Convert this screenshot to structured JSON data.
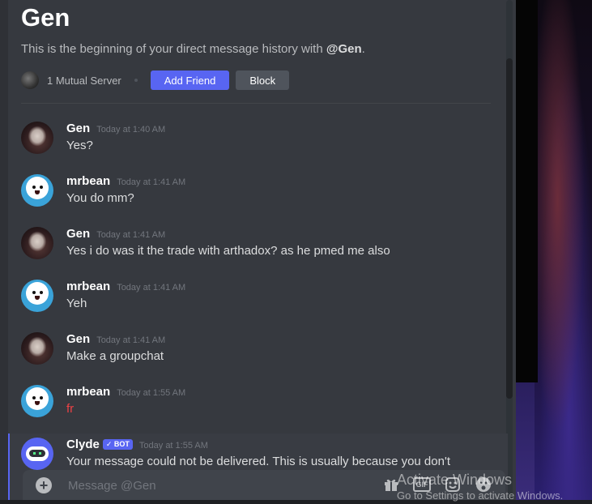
{
  "header": {
    "title": "Gen",
    "intro_prefix": "This is the beginning of your direct message history with ",
    "intro_handle": "@Gen",
    "intro_suffix": ".",
    "mutual_servers": "1 Mutual Server",
    "add_friend_label": "Add Friend",
    "block_label": "Block"
  },
  "messages": [
    {
      "username": "Gen",
      "timestamp": "Today at 1:40 AM",
      "content": "Yes?",
      "avatar": "gen-avatar"
    },
    {
      "username": "mrbean",
      "timestamp": "Today at 1:41 AM",
      "content": "You do mm?",
      "avatar": "mrbean-avatar"
    },
    {
      "username": "Gen",
      "timestamp": "Today at 1:41 AM",
      "content": "Yes i do was it the trade with arthadox? as he pmed me also",
      "avatar": "gen-avatar"
    },
    {
      "username": "mrbean",
      "timestamp": "Today at 1:41 AM",
      "content": "Yeh",
      "avatar": "mrbean-avatar"
    },
    {
      "username": "Gen",
      "timestamp": "Today at 1:41 AM",
      "content": "Make a groupchat",
      "avatar": "gen-avatar"
    },
    {
      "username": "mrbean",
      "timestamp": "Today at 1:55 AM",
      "content": "fr",
      "avatar": "mrbean-avatar"
    },
    {
      "username": "Clyde",
      "bot_tag": "✓ BOT",
      "timestamp": "Today at 1:55 AM",
      "content": "Your message could not be delivered. This is usually because you don't",
      "avatar": "clyde-avatar"
    }
  ],
  "composer": {
    "placeholder": "Message @Gen",
    "gif_label": "GIF"
  },
  "watermark": {
    "line1": "Activate Windows",
    "line2": "Go to Settings to activate Windows."
  },
  "colors": {
    "accent": "#5865f2",
    "background": "#36393f",
    "error_text": "#ed4245"
  }
}
